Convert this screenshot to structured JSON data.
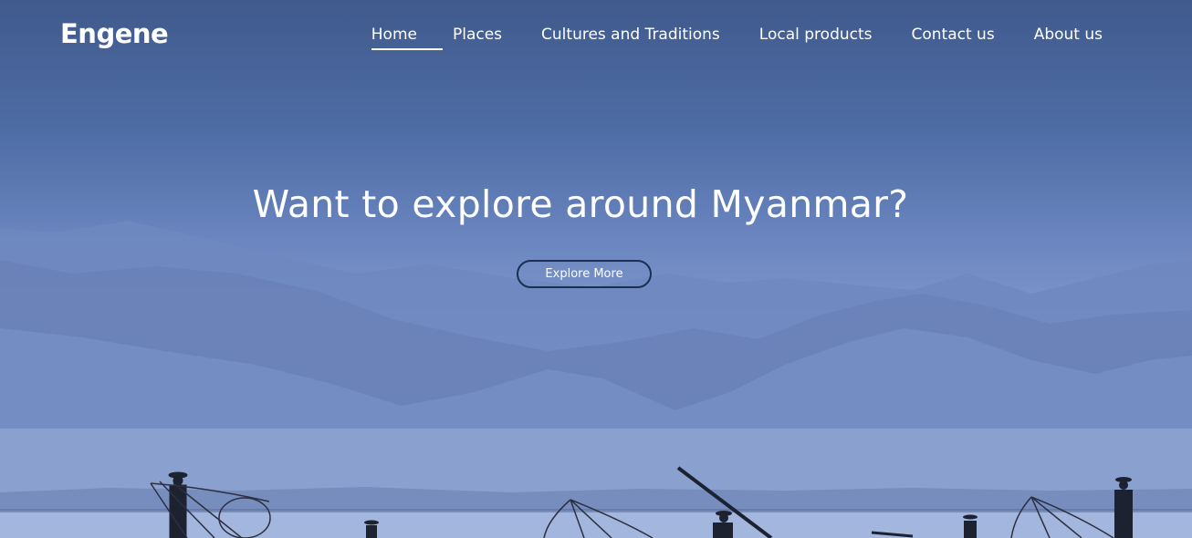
{
  "brand": {
    "logo_text": "Engene"
  },
  "nav": {
    "items": [
      {
        "label": "Home",
        "active": true
      },
      {
        "label": "Places",
        "active": false
      },
      {
        "label": "Cultures and Traditions",
        "active": false
      },
      {
        "label": "Local products",
        "active": false
      },
      {
        "label": "Contact us",
        "active": false
      },
      {
        "label": "About us",
        "active": false
      }
    ]
  },
  "hero": {
    "headline": "Want to explore around Myanmar?",
    "cta_label": "Explore More"
  },
  "colors": {
    "text": "#ffffff",
    "button_border": "#1b2f55",
    "sky_top": "#3f5a8c",
    "sky_bottom": "#a9badf"
  }
}
